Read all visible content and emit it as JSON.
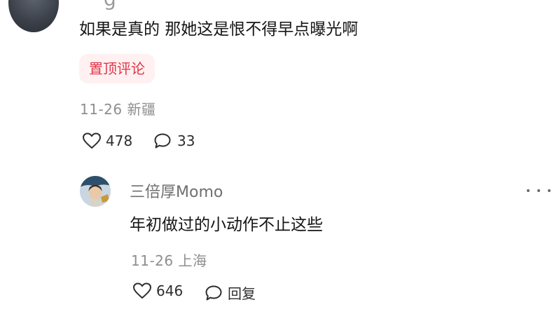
{
  "top_comment": {
    "username_fragment": "g",
    "text": "如果是真的 那她这是恨不得早点曝光啊",
    "pinned_badge": "置顶评论",
    "date": "11-26",
    "location": "新疆",
    "likes": "478",
    "replies": "33"
  },
  "reply_comment": {
    "username": "三倍厚Momo",
    "text": "年初做过的小动作不止这些",
    "date": "11-26",
    "location": "上海",
    "likes": "646",
    "reply_label": "回复"
  },
  "colors": {
    "accent": "#e0354a",
    "badge_bg": "#fff1f1",
    "meta": "#8e8e8e",
    "username": "#6f6f6f",
    "text": "#151515"
  },
  "icons": {
    "like": "heart-icon",
    "comment": "speech-bubble-icon",
    "more": "more-dots-icon"
  }
}
